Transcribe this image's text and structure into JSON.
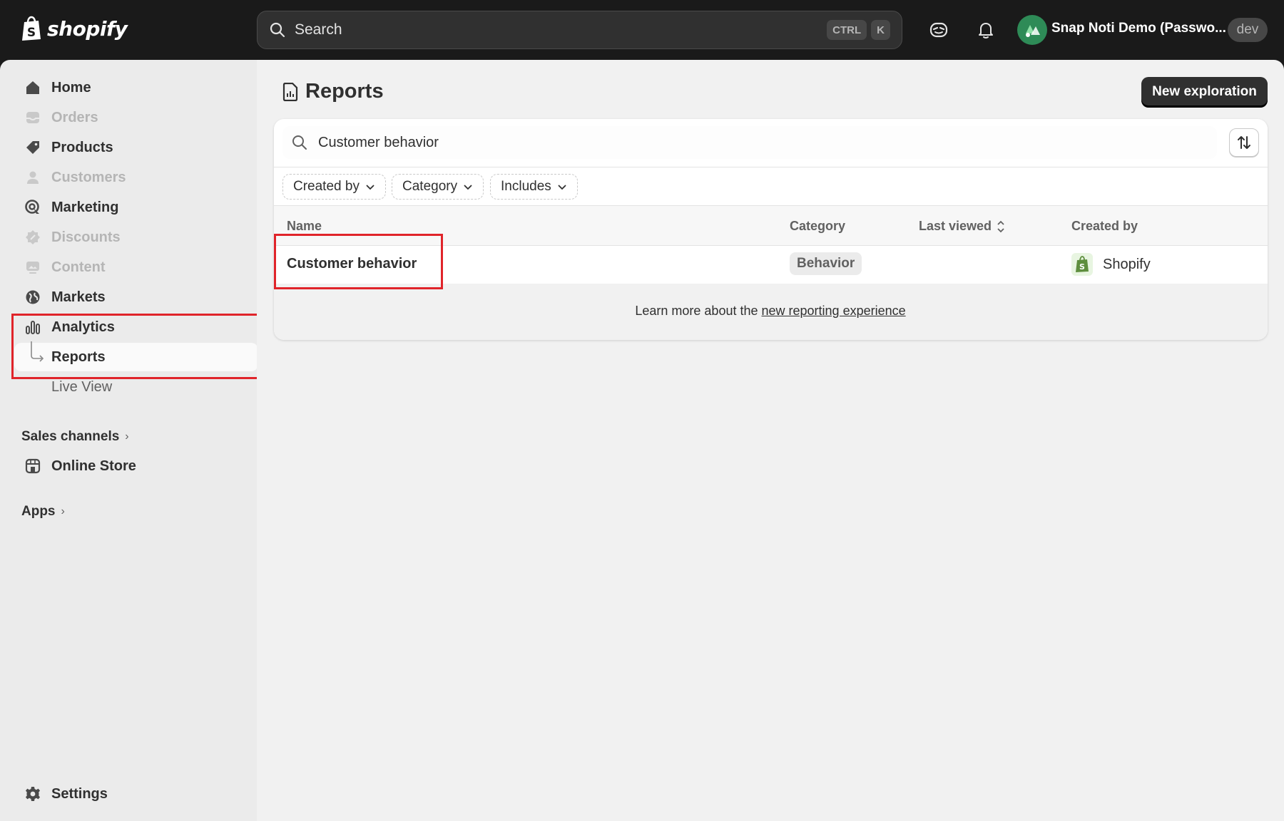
{
  "topbar": {
    "logo_text": "shopify",
    "search_placeholder": "Search",
    "shortcut_keys": [
      "CTRL",
      "K"
    ],
    "store_name": "Snap Noti Demo (Passwo...",
    "env_badge": "dev",
    "icons": [
      "search-icon",
      "sidekick-icon",
      "bell-icon",
      "store-avatar-icon"
    ]
  },
  "sidebar": {
    "items": [
      {
        "label": "Home",
        "icon": "home-icon",
        "disabled": false
      },
      {
        "label": "Orders",
        "icon": "inbox-icon",
        "disabled": true
      },
      {
        "label": "Products",
        "icon": "tag-icon",
        "disabled": false
      },
      {
        "label": "Customers",
        "icon": "person-icon",
        "disabled": true
      },
      {
        "label": "Marketing",
        "icon": "target-icon",
        "disabled": false
      },
      {
        "label": "Discounts",
        "icon": "discount-icon",
        "disabled": true
      },
      {
        "label": "Content",
        "icon": "image-icon",
        "disabled": true
      },
      {
        "label": "Markets",
        "icon": "globe-icon",
        "disabled": false
      },
      {
        "label": "Analytics",
        "icon": "bar-chart-icon",
        "disabled": false
      }
    ],
    "sub_items": [
      {
        "label": "Reports",
        "active": true
      },
      {
        "label": "Live View",
        "active": false
      }
    ],
    "sales_channels_label": "Sales channels",
    "online_store_label": "Online Store",
    "apps_label": "Apps",
    "settings_label": "Settings"
  },
  "main": {
    "page_title": "Reports",
    "new_exploration_label": "New exploration",
    "search_value": "Customer behavior",
    "filters": [
      "Created by",
      "Category",
      "Includes"
    ],
    "columns": [
      "Name",
      "Category",
      "Last viewed",
      "Created by"
    ],
    "rows": [
      {
        "name": "Customer behavior",
        "category": "Behavior",
        "last_viewed": "",
        "created_by": "Shopify"
      }
    ],
    "learn_more_prefix": "Learn more about the ",
    "learn_more_link": "new reporting experience"
  },
  "colors": {
    "highlight_box": "#e0242a",
    "topbar_bg": "#1a1a1a",
    "primary_button": "#303030"
  }
}
